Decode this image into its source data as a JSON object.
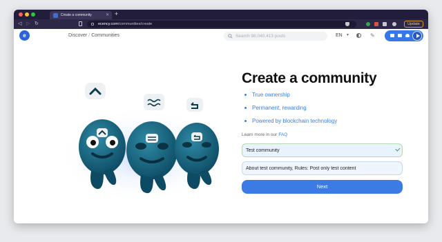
{
  "browser": {
    "tab_title": "Create a community",
    "url_domain": "ecency.com",
    "url_path": "/communities/create",
    "update_label": "Update",
    "traffic_colors": [
      "#fe5f57",
      "#febc2e",
      "#28c840"
    ]
  },
  "header": {
    "breadcrumb": [
      "Discover",
      "Communities"
    ],
    "search_placeholder": "Search 98,040,413 posts",
    "language": "EN"
  },
  "main": {
    "title": "Create a community",
    "features": [
      "True ownership",
      "Permanent, rewarding",
      "Powered by blockchain technology"
    ],
    "learn_prefix": "Learn more in our",
    "learn_link": "FAQ",
    "community_title_value": "Test community",
    "about_value": "About test community, Rules: Post only test content",
    "next_label": "Next"
  },
  "colors": {
    "accent": "#3c7be4",
    "brand": "#2b63d9",
    "field_bg": "#e8f3fd"
  }
}
